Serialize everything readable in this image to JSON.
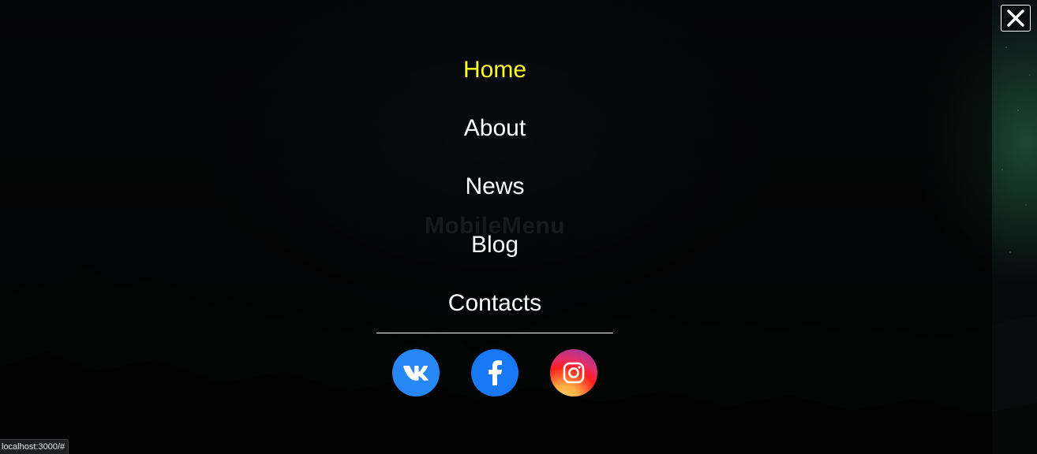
{
  "watermark": "MobileMenu",
  "menu": {
    "items": [
      {
        "label": "Home",
        "active": true
      },
      {
        "label": "About",
        "active": false
      },
      {
        "label": "News",
        "active": false
      },
      {
        "label": "Blog",
        "active": false
      },
      {
        "label": "Contacts",
        "active": false
      }
    ],
    "active_color": "#ffff29",
    "text_color": "#ffffff"
  },
  "socials": [
    {
      "name": "vk",
      "icon": "vk-icon",
      "color": "#2787f5"
    },
    {
      "name": "facebook",
      "icon": "facebook-icon",
      "color": "#1877f2"
    },
    {
      "name": "instagram",
      "icon": "instagram-icon",
      "colors": [
        "#833ab4",
        "#e1306c",
        "#fd1d1d",
        "#fcaf45"
      ]
    }
  ],
  "close_button": {
    "icon": "close-icon"
  },
  "status_bar": {
    "url": "localhost:3000/#"
  }
}
